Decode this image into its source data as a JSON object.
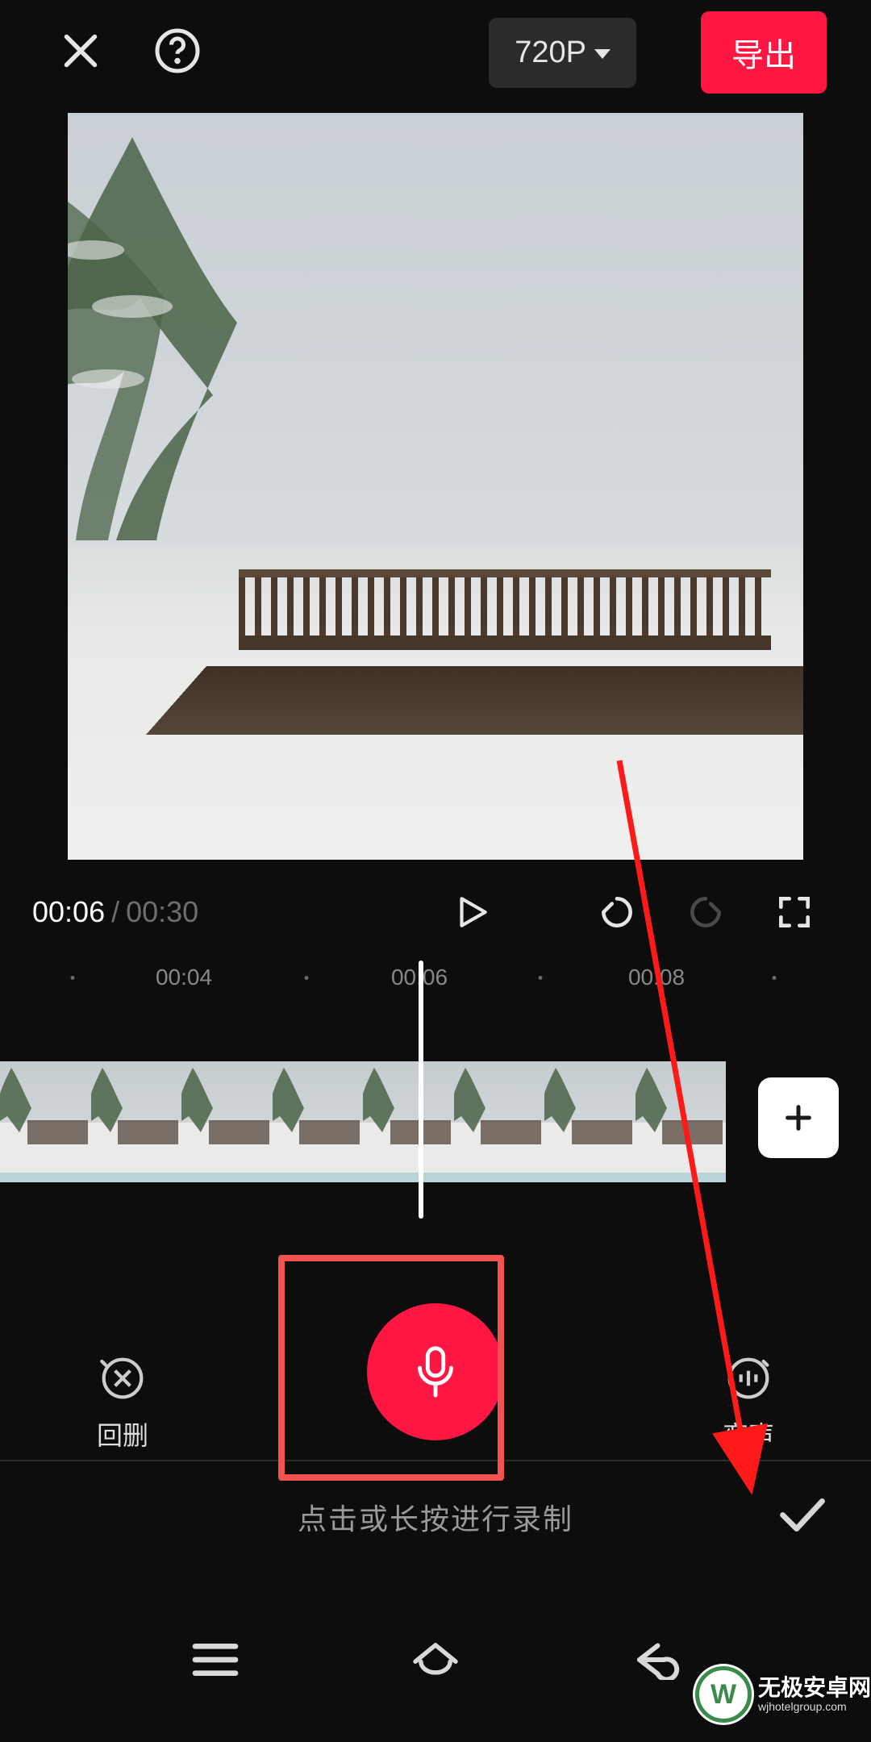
{
  "header": {
    "resolution_label": "720P",
    "export_label": "导出"
  },
  "playback": {
    "current_time": "00:06",
    "separator": "/",
    "total_time": "00:30",
    "ruler_ticks": [
      "00:04",
      "00:06",
      "00:08"
    ]
  },
  "record": {
    "undo_label": "回删",
    "voice_label": "变声",
    "hint_text": "点击或长按进行录制"
  },
  "watermark": {
    "brand": "无极安卓网",
    "url": "wjhotelgroup.com"
  },
  "colors": {
    "accent": "#ff1744",
    "outline": "#ef5350",
    "bg": "#0d0d0d",
    "muted": "#6e6e6e"
  }
}
